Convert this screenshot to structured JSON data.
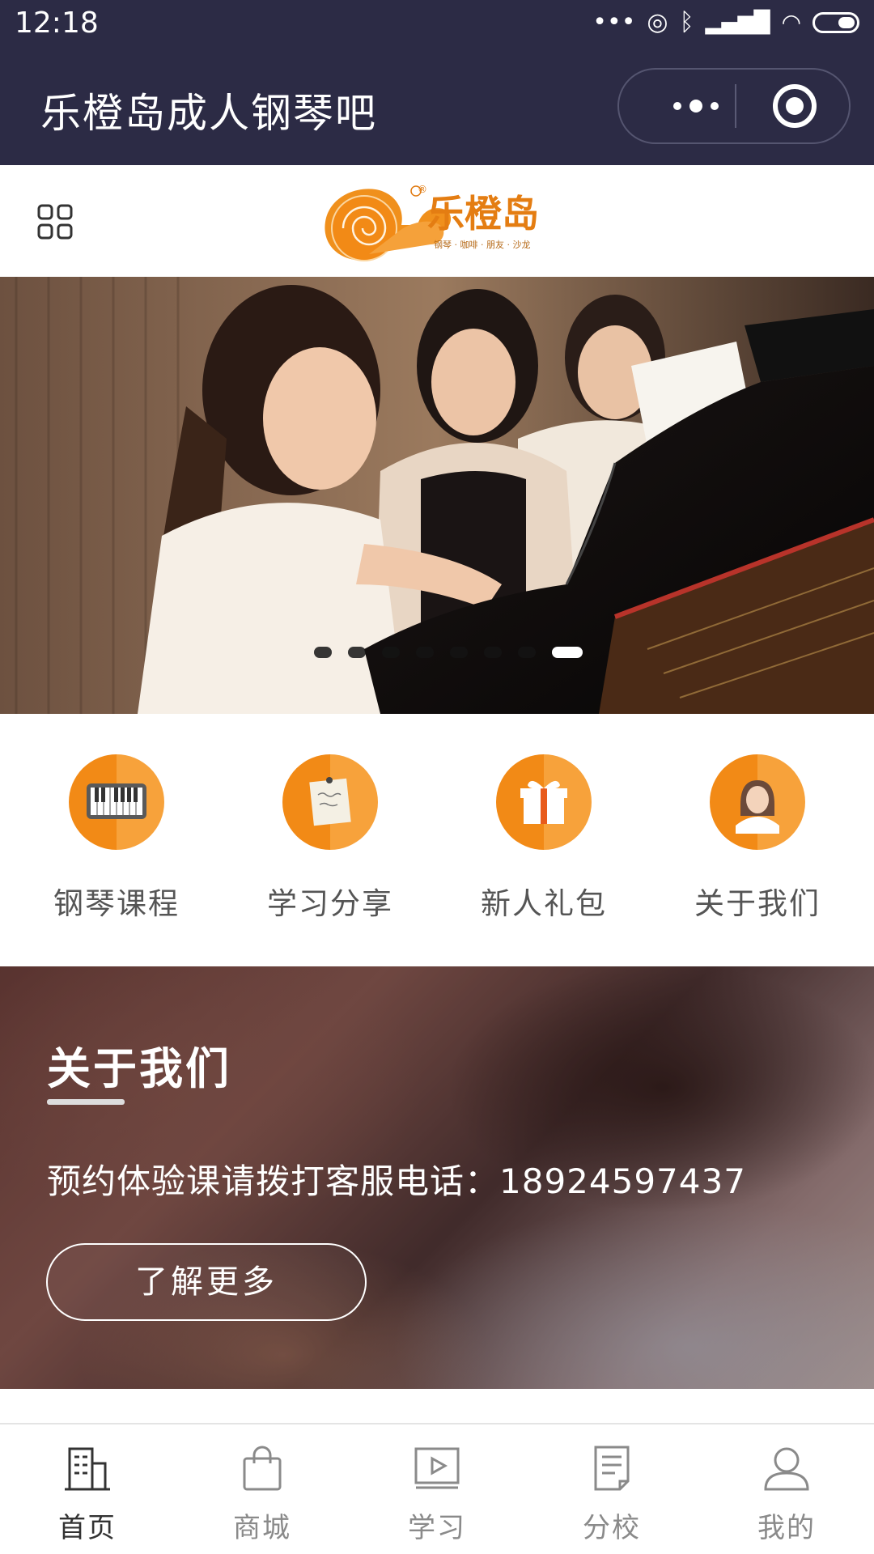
{
  "status_bar": {
    "time": "12:18",
    "indicators": [
      "more-dots-icon",
      "hotspot-icon",
      "bluetooth-icon",
      "hd-signal-icon",
      "wifi-icon",
      "battery-icon"
    ]
  },
  "title_bar": {
    "title": "乐橙岛成人钢琴吧",
    "more_icon": "more-dots-icon",
    "close_icon": "target-circle-icon"
  },
  "header": {
    "menu_icon": "grid-menu-icon",
    "logo": {
      "name": "乐橙岛",
      "tagline": "钢琴 · 咖啡 · 朋友 · 沙龙",
      "mark": "®"
    }
  },
  "banner": {
    "pager": {
      "count": 8,
      "active_index": 7
    }
  },
  "quick_nav": {
    "items": [
      {
        "label": "钢琴课程",
        "icon": "piano-keys-icon"
      },
      {
        "label": "学习分享",
        "icon": "note-paper-icon"
      },
      {
        "label": "新人礼包",
        "icon": "gift-box-icon"
      },
      {
        "label": "关于我们",
        "icon": "person-avatar-icon"
      }
    ]
  },
  "about": {
    "title": "关于我们",
    "text": "预约体验课请拨打客服电话：18924597437",
    "button_label": "了解更多"
  },
  "tab_bar": {
    "items": [
      {
        "label": "首页",
        "icon": "building-icon",
        "active": true
      },
      {
        "label": "商城",
        "icon": "shopping-bag-icon",
        "active": false
      },
      {
        "label": "学习",
        "icon": "video-play-icon",
        "active": false
      },
      {
        "label": "分校",
        "icon": "document-icon",
        "active": false
      },
      {
        "label": "我的",
        "icon": "user-icon",
        "active": false
      }
    ]
  },
  "colors": {
    "title_bar_bg": "#2c2b45",
    "accent_orange": "#f28a16",
    "accent_orange_light": "#f7a23b",
    "tab_active": "#333333",
    "tab_inactive": "#8a8a8a"
  }
}
